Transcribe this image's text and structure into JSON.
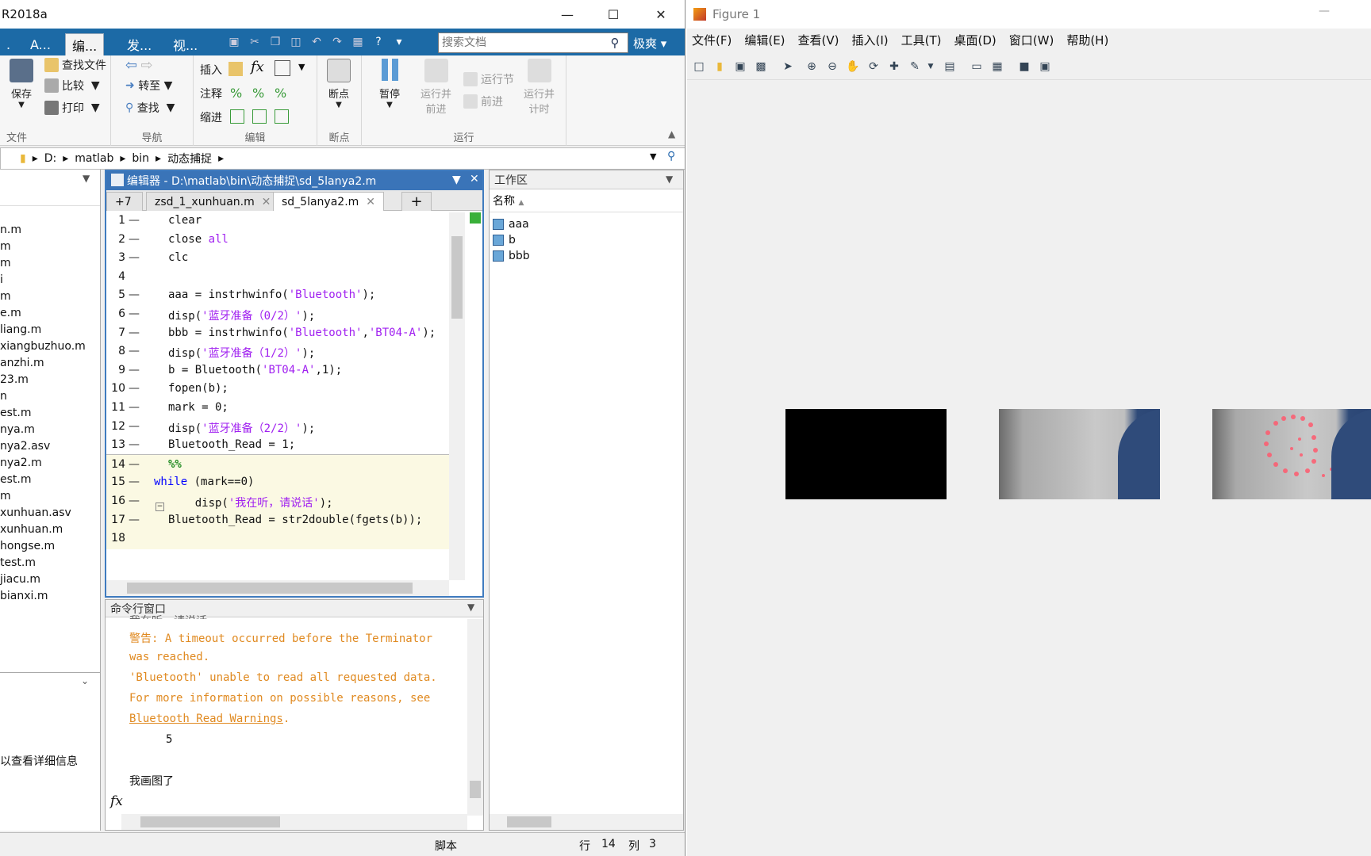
{
  "matlab": {
    "title": "R2018a",
    "ribbon_tabs": [
      "A...",
      "编...",
      "发...",
      "视..."
    ],
    "search_placeholder": "搜索文档",
    "user": "极爽",
    "file_group": {
      "label": "文件",
      "save": "保存",
      "find_files": "查找文件",
      "compare": "比较",
      "print": "打印"
    },
    "nav_group": {
      "label": "导航",
      "goto": "转至",
      "find": "查找"
    },
    "edit_group": {
      "label": "编辑",
      "insert": "插入",
      "comment": "注释",
      "indent": "缩进"
    },
    "bp_group": {
      "label": "断点",
      "breakpoints": "断点"
    },
    "run_group": {
      "label": "运行",
      "pause": "暂停",
      "run_advance_l1": "运行并",
      "run_advance_l2": "前进",
      "run_section": "运行节",
      "advance": "前进",
      "run_time_l1": "运行并",
      "run_time_l2": "计时"
    },
    "path": [
      "D:",
      "matlab",
      "bin",
      "动态捕捉"
    ],
    "files": [
      "n.m",
      "m",
      "m",
      "i",
      "m",
      "e.m",
      "liang.m",
      "xiangbuzhuo.m",
      "anzhi.m",
      "23.m",
      "n",
      "est.m",
      "nya.m",
      "nya2.asv",
      "nya2.m",
      "est.m",
      "m",
      "xunhuan.asv",
      "xunhuan.m",
      "hongse.m",
      "test.m",
      "jiacu.m",
      "bianxi.m"
    ],
    "details_hint": "以查看详细信息",
    "editor": {
      "title": "编辑器 - D:\\matlab\\bin\\动态捕捉\\sd_5lanya2.m",
      "more_tabs": "+7",
      "tabs": [
        "zsd_1_xunhuan.m",
        "sd_5lanya2.m"
      ],
      "lines": [
        {
          "n": "1",
          "code": "clear"
        },
        {
          "n": "2",
          "code": "close all"
        },
        {
          "n": "3",
          "code": "clc"
        },
        {
          "n": "4",
          "code": ""
        },
        {
          "n": "5",
          "code": "aaa = instrhwinfo('Bluetooth');"
        },
        {
          "n": "6",
          "code": "disp('蓝牙准备（0/2）');"
        },
        {
          "n": "7",
          "code": "bbb = instrhwinfo('Bluetooth','BT04-A');"
        },
        {
          "n": "8",
          "code": "disp('蓝牙准备（1/2）');"
        },
        {
          "n": "9",
          "code": "b = Bluetooth('BT04-A',1);"
        },
        {
          "n": "10",
          "code": "fopen(b);"
        },
        {
          "n": "11",
          "code": "mark = 0;"
        },
        {
          "n": "12",
          "code": "disp('蓝牙准备（2/2）');"
        },
        {
          "n": "13",
          "code": "Bluetooth_Read = 1;"
        },
        {
          "n": "14",
          "code": "%%"
        },
        {
          "n": "15",
          "code": "while (mark==0)"
        },
        {
          "n": "16",
          "code": "    disp('我在听，请说话');"
        },
        {
          "n": "17",
          "code": "Bluetooth_Read = str2double(fgets(b));"
        },
        {
          "n": "18",
          "code": ""
        }
      ]
    },
    "command_window": {
      "title": "命令行窗口",
      "partial_top": "我在听，请说话",
      "warn1": "警告: A timeout occurred before the Terminator",
      "warn2": "was reached.",
      "warn3": "'Bluetooth' unable to read all requested data.",
      "warn4": "For more information on possible reasons, see",
      "warn_link": "Bluetooth Read Warnings",
      "warn_period": ".",
      "value": "5",
      "msg": "我画图了",
      "prompt": "fx"
    },
    "workspace": {
      "title": "工作区",
      "col_name": "名称",
      "vars": [
        "aaa",
        "b",
        "bbb"
      ]
    },
    "status": {
      "mode": "脚本",
      "row_label": "行",
      "row": "14",
      "col_label": "列",
      "col": "3"
    }
  },
  "figure": {
    "title": "Figure 1",
    "menu": [
      "文件(F)",
      "编辑(E)",
      "查看(V)",
      "插入(I)",
      "工具(T)",
      "桌面(D)",
      "窗口(W)",
      "帮助(H)"
    ]
  }
}
